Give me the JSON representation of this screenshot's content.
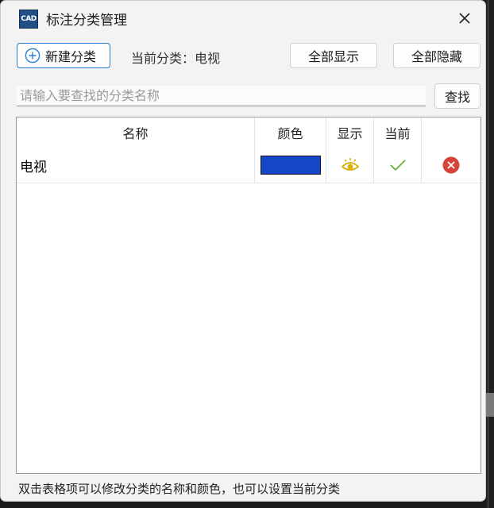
{
  "window": {
    "app_icon_text": "CAD",
    "title": "标注分类管理"
  },
  "toolbar": {
    "new_label": "新建分类",
    "current_label": "当前分类：电视",
    "show_all_label": "全部显示",
    "hide_all_label": "全部隐藏"
  },
  "search": {
    "placeholder": "请输入要查找的分类名称",
    "value": "",
    "button_label": "查找"
  },
  "table": {
    "headers": [
      "名称",
      "颜色",
      "显示",
      "当前"
    ],
    "rows": [
      {
        "name": "电视",
        "color": "#1446c8",
        "visible": true,
        "current": true,
        "icons": {
          "visible": "eye-icon",
          "current": "checkmark-icon",
          "delete": "delete-icon"
        }
      }
    ]
  },
  "status": {
    "hint": "双击表格项可以修改分类的名称和颜色，也可以设置当前分类"
  },
  "colors": {
    "accent": "#2b7cd3",
    "eye": "#d4b000",
    "check": "#6cae3a",
    "delete": "#d9443a"
  }
}
